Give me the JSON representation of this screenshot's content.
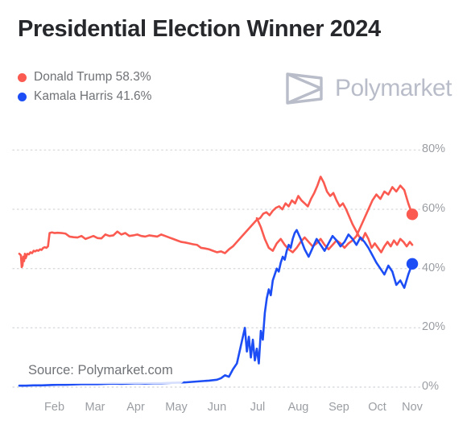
{
  "header": {
    "title": "Presidential Election Winner 2024",
    "brand_name": "Polymarket",
    "brand_logo_icon": "polymarket-logo-icon"
  },
  "legend": {
    "items": [
      {
        "label": "Donald Trump 58.3%",
        "color": "#FA5A50",
        "name": "Donald Trump",
        "value": "58.3%"
      },
      {
        "label": "Kamala Harris 41.6%",
        "color": "#1D4EF5",
        "name": "Kamala Harris",
        "value": "41.6%"
      }
    ]
  },
  "source": {
    "text": "Source: Polymarket.com"
  },
  "colors": {
    "trump": "#FA5A50",
    "harris": "#1D4EF5",
    "grid": "#d8dadd",
    "axis_text": "#9a9ea3",
    "title_text": "#26282c",
    "brand_grey": "#b9bdc9",
    "background": "#ffffff"
  },
  "chart_data": {
    "type": "line",
    "title": "Presidential Election Winner 2024",
    "xlabel": "",
    "ylabel": "",
    "ylim": [
      0,
      85
    ],
    "yticks": [
      0,
      20,
      40,
      60,
      80
    ],
    "ytick_labels": [
      "0%",
      "20%",
      "40%",
      "60%",
      "80%"
    ],
    "grid": true,
    "grid_style": "dotted-horizontal",
    "legend_position": "top-left",
    "xlim": [
      0,
      100
    ],
    "xticks": [
      9.2,
      19.4,
      29.6,
      39.8,
      50.0,
      60.2,
      70.4,
      80.6,
      90.2,
      99.0
    ],
    "xtick_labels": [
      "Feb",
      "Mar",
      "Apr",
      "May",
      "Jun",
      "Jul",
      "Aug",
      "Sep",
      "Oct",
      "Nov"
    ],
    "endpoint_markers": [
      {
        "series": "Donald Trump",
        "x": 99.0,
        "y": 58.3,
        "color": "#FA5A50"
      },
      {
        "series": "Kamala Harris",
        "x": 99.0,
        "y": 41.6,
        "color": "#1D4EF5"
      }
    ],
    "series": [
      {
        "name": "Donald Trump",
        "color": "#FA5A50",
        "x": [
          0.4,
          0.8,
          1.0,
          1.2,
          1.4,
          1.6,
          1.8,
          2.0,
          2.4,
          2.8,
          3.2,
          3.6,
          4.0,
          4.4,
          4.8,
          5.2,
          5.6,
          6.0,
          6.4,
          6.8,
          7.2,
          7.6,
          8.0,
          8.6,
          9.2,
          10.0,
          11.0,
          12.0,
          13.0,
          14.0,
          15.0,
          16.0,
          17.0,
          18.0,
          19.0,
          20.0,
          21.0,
          22.0,
          23.0,
          24.0,
          25.0,
          26.0,
          27.0,
          28.0,
          29.0,
          30.0,
          31.0,
          32.0,
          33.0,
          34.0,
          35.0,
          36.0,
          37.0,
          38.0,
          39.0,
          40.0,
          41.0,
          42.0,
          43.0,
          44.0,
          45.0,
          46.0,
          47.0,
          48.0,
          49.0,
          50.0,
          51.0,
          52.0,
          53.0,
          54.0,
          55.0,
          56.0,
          57.0,
          58.0,
          59.0,
          60.0,
          60.8,
          61.6,
          62.4,
          63.2,
          64.0,
          64.8,
          65.6,
          66.4,
          67.2,
          68.0,
          68.8,
          69.6,
          70.4,
          71.2,
          72.0,
          72.8,
          73.6,
          74.4,
          75.2,
          76.0,
          76.8,
          77.6,
          78.4,
          79.2,
          80.0,
          80.8,
          81.6,
          82.4,
          83.2,
          84.0,
          84.8,
          85.6,
          86.4,
          87.2,
          88.0,
          88.8,
          89.6,
          90.4,
          91.2,
          92.0,
          92.8,
          93.6,
          94.4,
          95.2,
          96.0,
          96.8,
          97.6,
          98.4,
          99.0
        ],
        "y": [
          45.0,
          44.5,
          40.5,
          41.0,
          44.0,
          42.5,
          45.0,
          43.5,
          45.0,
          44.8,
          45.5,
          45.2,
          46.0,
          45.8,
          46.2,
          46.0,
          46.5,
          46.3,
          47.0,
          47.2,
          47.0,
          47.5,
          52.0,
          52.2,
          52.0,
          52.1,
          52.0,
          51.8,
          50.8,
          50.6,
          50.5,
          51.0,
          50.0,
          50.5,
          51.0,
          50.3,
          50.2,
          51.5,
          51.0,
          51.2,
          52.5,
          51.5,
          52.0,
          51.0,
          51.2,
          51.5,
          51.0,
          50.8,
          51.2,
          51.0,
          50.8,
          51.5,
          51.0,
          50.5,
          50.0,
          49.5,
          49.0,
          48.8,
          48.5,
          48.2,
          48.0,
          47.0,
          46.8,
          46.5,
          46.0,
          45.5,
          45.8,
          45.2,
          46.5,
          47.5,
          49.0,
          50.5,
          52.0,
          53.5,
          55.0,
          56.5,
          57.0,
          58.5,
          59.0,
          58.0,
          59.5,
          60.5,
          61.0,
          60.0,
          62.0,
          61.0,
          63.0,
          62.0,
          64.5,
          63.0,
          62.0,
          61.0,
          63.5,
          65.5,
          68.0,
          71.0,
          69.0,
          66.0,
          64.5,
          65.5,
          63.0,
          61.0,
          62.0,
          60.0,
          57.5,
          55.0,
          53.0,
          51.0,
          49.5,
          52.0,
          50.0,
          47.0,
          48.5,
          47.0,
          45.5,
          47.5,
          49.0,
          47.5,
          49.5,
          48.0,
          50.0,
          49.0,
          47.5,
          49.0,
          48.0
        ]
      },
      {
        "name": "Donald Trump (cont)",
        "color": "#FA5A50",
        "x": [
          60.0,
          61.0,
          62.0,
          63.0,
          64.0,
          65.0,
          66.0,
          67.0,
          68.0,
          69.0,
          70.0,
          71.0,
          72.0,
          73.0,
          74.0,
          75.0,
          76.0,
          77.0,
          78.0,
          79.0,
          80.0,
          81.0,
          82.0,
          83.0,
          84.0,
          85.0,
          86.0,
          87.0,
          88.0,
          89.0,
          90.0,
          91.0,
          92.0,
          93.0,
          94.0,
          95.0,
          96.0,
          97.0,
          98.0,
          99.0
        ],
        "y": [
          57.0,
          54.0,
          50.0,
          47.0,
          46.0,
          48.5,
          50.0,
          48.0,
          46.5,
          45.5,
          47.0,
          49.0,
          50.5,
          49.0,
          47.5,
          48.5,
          50.0,
          48.0,
          46.5,
          48.0,
          49.5,
          48.5,
          47.0,
          48.5,
          49.5,
          51.0,
          54.0,
          57.0,
          60.0,
          63.0,
          65.0,
          63.5,
          66.0,
          65.0,
          67.5,
          66.0,
          68.0,
          66.5,
          62.0,
          58.3
        ]
      },
      {
        "name": "Kamala Harris",
        "color": "#1D4EF5",
        "x": [
          0.4,
          2.0,
          4.0,
          6.0,
          8.0,
          10.0,
          12.0,
          14.0,
          16.0,
          18.0,
          20.0,
          22.0,
          24.0,
          26.0,
          28.0,
          30.0,
          32.0,
          34.0,
          36.0,
          38.0,
          40.0,
          42.0,
          44.0,
          46.0,
          48.0,
          50.0,
          51.0,
          52.0,
          53.0,
          54.0,
          55.0,
          56.0,
          57.0,
          57.5,
          58.0,
          58.5,
          59.0,
          59.5,
          60.0,
          60.5,
          61.0,
          61.5,
          62.0,
          62.5,
          63.0,
          63.5,
          64.0,
          64.5,
          65.0,
          65.5,
          66.0,
          66.5,
          67.0,
          67.5,
          68.0,
          68.5,
          69.0,
          69.5,
          70.0,
          71.0,
          72.0,
          73.0,
          74.0,
          75.0,
          76.0,
          77.0,
          78.0,
          79.0,
          80.0,
          81.0,
          82.0,
          83.0,
          84.0,
          85.0,
          86.0,
          87.0,
          88.0,
          89.0,
          90.0,
          91.0,
          92.0,
          93.0,
          94.0,
          95.0,
          96.0,
          97.0,
          98.0,
          99.0
        ],
        "y": [
          0.5,
          0.5,
          0.6,
          0.6,
          0.7,
          0.8,
          0.8,
          0.9,
          1.0,
          1.0,
          1.0,
          1.1,
          1.2,
          1.1,
          1.2,
          1.3,
          1.2,
          1.3,
          1.3,
          1.4,
          1.5,
          1.6,
          1.8,
          2.0,
          2.2,
          2.5,
          3.0,
          4.0,
          3.5,
          6.0,
          8.0,
          14.0,
          20.0,
          12.0,
          17.0,
          10.0,
          16.0,
          9.0,
          13.0,
          8.0,
          19.0,
          16.0,
          25.0,
          30.0,
          33.0,
          31.0,
          36.0,
          38.0,
          40.0,
          39.0,
          42.0,
          44.0,
          43.0,
          46.0,
          48.0,
          47.0,
          50.0,
          52.0,
          53.0,
          50.0,
          46.5,
          44.0,
          47.0,
          50.0,
          48.0,
          46.0,
          48.5,
          51.0,
          49.5,
          47.5,
          49.0,
          51.5,
          50.0,
          48.0,
          50.5,
          49.0,
          47.0,
          44.5,
          42.0,
          40.0,
          38.0,
          41.0,
          39.0,
          34.5,
          36.0,
          33.5,
          38.0,
          41.6
        ]
      }
    ]
  }
}
